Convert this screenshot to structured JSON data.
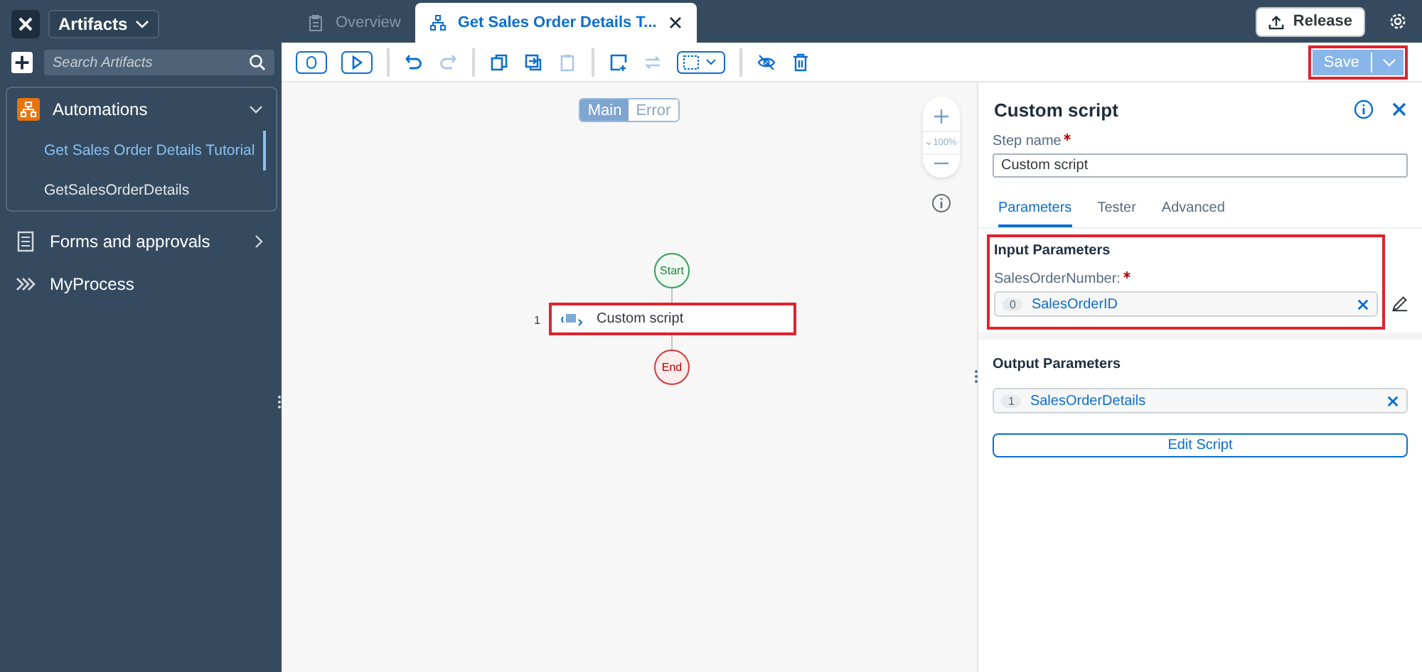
{
  "sidebar": {
    "workspace": "Artifacts",
    "search": {
      "placeholder": "Search Artifacts"
    },
    "items": [
      {
        "kind": "automation",
        "label": "Automations",
        "expanded": true,
        "children": [
          {
            "label": "Get Sales Order Details Tutorial",
            "selected": true
          },
          {
            "label": "GetSalesOrderDetails",
            "selected": false
          }
        ]
      },
      {
        "kind": "form",
        "label": "Forms and approvals",
        "expanded": false
      },
      {
        "kind": "process",
        "label": "MyProcess"
      }
    ]
  },
  "tabs": [
    {
      "kind": "overview",
      "label": "Overview",
      "selected": false
    },
    {
      "kind": "process",
      "label": "Get Sales Order Details T...",
      "selected": true
    }
  ],
  "release_button": "Release",
  "save_button": {
    "label": "Save",
    "highlighted": true
  },
  "canvas": {
    "flow_switch": [
      {
        "label": "Main",
        "selected": true
      },
      {
        "label": "Error",
        "selected": false
      }
    ],
    "zoom": "100%",
    "nodes": [
      {
        "kind": "start",
        "label": "Start"
      },
      {
        "kind": "step",
        "label": "Custom script",
        "number": "1",
        "highlighted": true
      },
      {
        "kind": "end",
        "label": "End"
      }
    ]
  },
  "panel": {
    "title": "Custom script",
    "step_name_label": "Step name",
    "step_name_required": true,
    "step_name": "Custom script",
    "tabs": [
      {
        "label": "Parameters",
        "selected": true
      },
      {
        "label": "Tester",
        "selected": false
      },
      {
        "label": "Advanced",
        "selected": false
      }
    ],
    "input": {
      "title": "Input Parameters",
      "highlighted": true,
      "params": [
        {
          "label": "SalesOrderNumber:",
          "required": true,
          "index": "0",
          "value": "SalesOrderID"
        }
      ]
    },
    "output": {
      "title": "Output Parameters",
      "params": [
        {
          "index": "1",
          "value": "SalesOrderDetails"
        }
      ]
    },
    "edit_button": "Edit Script"
  }
}
